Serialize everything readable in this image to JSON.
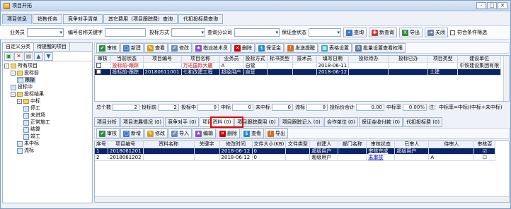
{
  "window": {
    "title": "项目开拓",
    "buttons": [
      "-",
      "□",
      "✕"
    ]
  },
  "main_tabs": [
    {
      "label": "项目信息",
      "active": true
    },
    {
      "label": "销售任务",
      "active": false
    },
    {
      "label": "竞争对手清单",
      "active": false
    },
    {
      "label": "其它费用（项目跟踪费）查询",
      "active": false
    },
    {
      "label": "代扣投标费查询",
      "active": false
    }
  ],
  "filter": {
    "salesperson_label": "业务员",
    "code_keyword_label": "编号名称关键字",
    "bid_method_label": "投标方式",
    "query_company_label": "查询分公司",
    "deposit_status_label": "保证金状态",
    "query_btn": "查询",
    "new_btn": "新查询",
    "export_btn": "导出",
    "close_btn": "关闭",
    "combined_filter_label": "符合条件筛选"
  },
  "left_panel": {
    "tabs": [
      "自定义分类",
      "待提醒的项目"
    ],
    "tree": [
      {
        "label": "所有项目",
        "level": 0,
        "type": "folder",
        "expand": "-"
      },
      {
        "label": "投标前",
        "level": 1,
        "type": "folder",
        "expand": "-"
      },
      {
        "label": "跟踪",
        "level": 2,
        "type": "leaf",
        "selected": true
      },
      {
        "label": "投标中",
        "level": 1,
        "type": "leaf"
      },
      {
        "label": "投标结果",
        "level": 1,
        "type": "folder",
        "expand": "-"
      },
      {
        "label": "中标",
        "level": 2,
        "type": "folder",
        "expand": "-"
      },
      {
        "label": "停工",
        "level": 3,
        "type": "leaf"
      },
      {
        "label": "未进场",
        "level": 3,
        "type": "leaf"
      },
      {
        "label": "正常施工",
        "level": 3,
        "type": "leaf"
      },
      {
        "label": "结算",
        "level": 3,
        "type": "leaf"
      },
      {
        "label": "竣工",
        "level": 3,
        "type": "leaf"
      },
      {
        "label": "未中标",
        "level": 2,
        "type": "leaf"
      },
      {
        "label": "流标",
        "level": 2,
        "type": "leaf"
      }
    ]
  },
  "toolbar": {
    "buttons": [
      "审核",
      "新建",
      "查看",
      "修改",
      "指派技术员",
      "删除",
      "保证金",
      "发送提醒",
      "表格设置",
      "批量设置查看权限"
    ]
  },
  "project_table": {
    "columns": [
      "审核",
      "当前状态",
      "项目编号",
      "项目名称",
      "业务员",
      "投标方式",
      "标书类型",
      "技术员",
      "填写日期",
      "投标待办",
      "投标已办",
      "项目类型",
      "建设单位"
    ],
    "rows": [
      {
        "cells": [
          "",
          "投标前-跟踪",
          "",
          "万达国际大厦",
          "A",
          "自营",
          "",
          "",
          "2018-06-11",
          "",
          "",
          "",
          "中铁建设集团有限"
        ],
        "selected": false
      },
      {
        "cells": [
          "",
          "投标前-跟踪",
          "20180611001",
          "七和改建工程",
          "超级用户",
          "自营",
          "",
          "",
          "2018-06-12",
          "",
          "",
          "土建",
          ""
        ],
        "selected": true
      }
    ]
  },
  "stats": {
    "total_label": "总个数",
    "total": "2",
    "before_label": "投标前",
    "before": "2",
    "during_label": "投标中",
    "during": "0",
    "won_label": "中标",
    "won": "0",
    "lost_label": "未中标",
    "lost": "0",
    "failed_label": "流标",
    "failed": "0",
    "amount_label": "投标价合计",
    "amount": "0.00",
    "rate_label": "中标率",
    "rate": "0.00%",
    "note": "注：中标率=中标/(中标+未中标)"
  },
  "sub_tabs": [
    {
      "label": "项目分析",
      "active": false
    },
    {
      "label": "项目进展情况 (0)",
      "active": false
    },
    {
      "label": "竞争对手 (0)",
      "active": false
    },
    {
      "label": "项目资料 (0)",
      "active": true
    },
    {
      "label": "项目跟踪费用 (0)",
      "active": false
    },
    {
      "label": "项目跟踪记入 (0)",
      "active": false
    },
    {
      "label": "合作单位 (0)",
      "active": false
    },
    {
      "label": "保证金收付款 (0)",
      "active": false
    },
    {
      "label": "代扣投标费 (0)",
      "active": false
    }
  ],
  "sub_toolbar": {
    "buttons": [
      "审核",
      "新增",
      "修改",
      "导入",
      "编辑",
      "删除",
      "查看",
      "导出"
    ]
  },
  "doc_table": {
    "columns": [
      "序号",
      "项目编号",
      "资料名称",
      "关键字",
      "修改时间",
      "文件大小(KB)",
      "文件类型",
      "创建人",
      "部门名称",
      "审核状态",
      "已审人",
      "待审人",
      "审核否"
    ],
    "rows": [
      {
        "cells": [
          "1",
          "2018061201",
          "",
          "",
          "2018-06-12",
          "0",
          "",
          "超级用户",
          "",
          "审核完成",
          "超级用户",
          "",
          "☑"
        ],
        "selected": true
      },
      {
        "cells": [
          "2",
          "2018061202",
          "",
          "",
          "2018-06-12",
          "0",
          "",
          "超级用户",
          "",
          "未审核",
          "",
          "A",
          "☐"
        ],
        "selected": false
      }
    ]
  },
  "colors": {
    "title_bg": "#c2d7ef",
    "selected_row": "#0a246a",
    "red_text": "#d00000",
    "highlight": "#e00000"
  }
}
